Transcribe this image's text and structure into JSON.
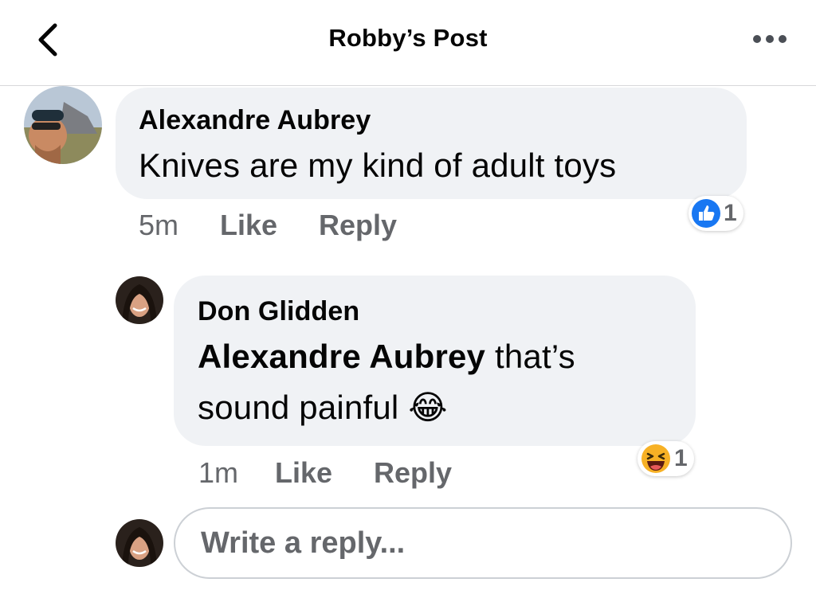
{
  "header": {
    "title": "Robby’s Post",
    "back_icon": "chevron-left-icon",
    "more_icon": "more-horizontal-icon"
  },
  "comments": [
    {
      "author": "Alexandre Aubrey",
      "text": "Knives are my kind of adult toys",
      "time": "5m",
      "like_label": "Like",
      "reply_label": "Reply",
      "reaction": {
        "icon": "like-thumb-icon",
        "count": "1"
      }
    },
    {
      "author": "Don Glidden",
      "mention": "Alexandre Aubrey",
      "text_line1": "that’s",
      "text_line2": "sound painful",
      "emoji": "😂",
      "time": "1m",
      "like_label": "Like",
      "reply_label": "Reply",
      "reaction": {
        "icon": "haha-emoji-icon",
        "count": "1"
      }
    }
  ],
  "reply_box": {
    "placeholder": "Write a reply..."
  },
  "colors": {
    "bubble": "#f0f2f5",
    "meta_text": "#65676b",
    "like_blue": "#1877f2",
    "haha_yellow": "#f7b125"
  }
}
